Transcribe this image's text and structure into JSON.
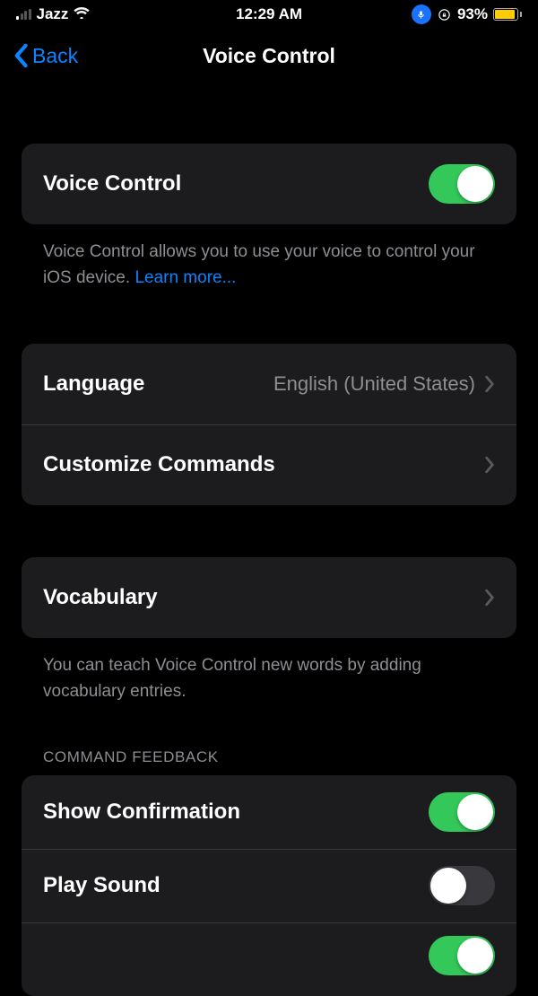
{
  "status": {
    "carrier": "Jazz",
    "time": "12:29 AM",
    "battery_percent": "93%"
  },
  "nav": {
    "back": "Back",
    "title": "Voice Control"
  },
  "main_toggle": {
    "label": "Voice Control",
    "footer_prefix": "Voice Control allows you to use your voice to control your iOS device. ",
    "learn_more": "Learn more..."
  },
  "language": {
    "label": "Language",
    "value": "English (United States)"
  },
  "customize": {
    "label": "Customize Commands"
  },
  "vocabulary": {
    "label": "Vocabulary",
    "footer": "You can teach Voice Control new words by adding vocabulary entries."
  },
  "feedback": {
    "header": "COMMAND FEEDBACK",
    "show_confirmation": "Show Confirmation",
    "play_sound": "Play Sound"
  }
}
